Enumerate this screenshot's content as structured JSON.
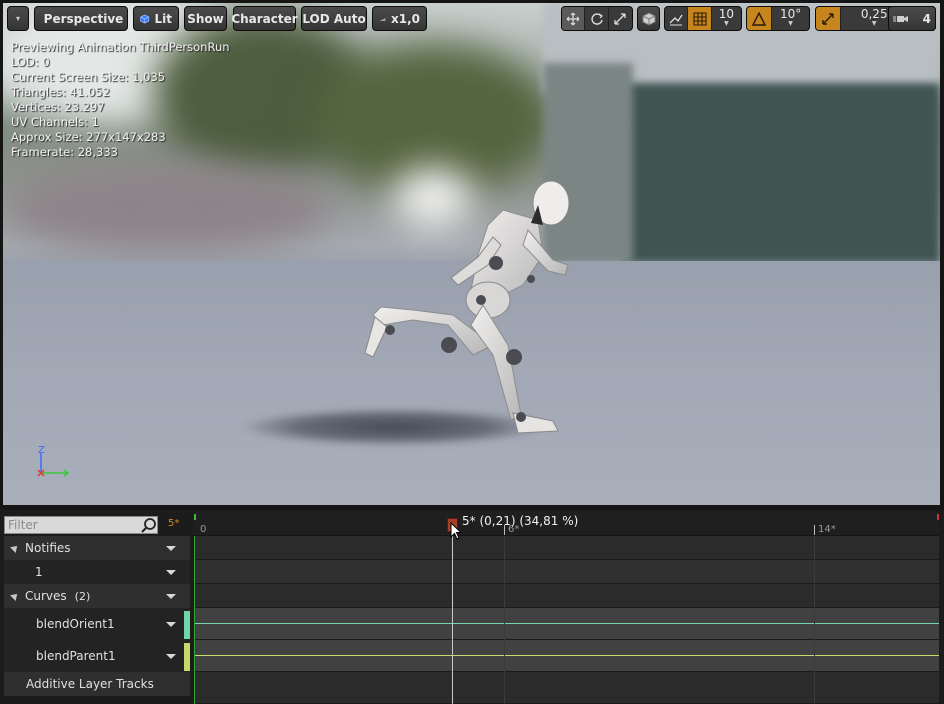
{
  "toolbar": {
    "menu_caret": "▾",
    "perspective_label": "Perspective",
    "lit_label": "Lit",
    "show_label": "Show",
    "character_label": "Character",
    "lod_label": "LOD Auto",
    "speed_label": "x1,0",
    "grid_snap_value": "10",
    "rotation_snap_value": "10°",
    "scale_snap_value": "0,25",
    "camera_speed_value": "4"
  },
  "stats": {
    "previewing": "Previewing Animation ThirdPersonRun",
    "lod": "LOD: 0",
    "screen_size": "Current Screen Size: 1,035",
    "triangles": "Triangles: 41.052",
    "vertices": "Vertices: 23.297",
    "uv_channels": "UV Channels: 1",
    "approx_size": "Approx Size: 277x147x283",
    "framerate": "Framerate: 28,333"
  },
  "axes": {
    "z_label": "Z"
  },
  "timeline": {
    "filter_placeholder": "Filter",
    "frame_marker": "5*",
    "ruler": {
      "start": "0",
      "mid": "6*",
      "end": "14*"
    },
    "playhead_label": "5* (0,21) (34,81 %)",
    "tracks": {
      "notifies_label": "Notifies",
      "notify_track_label": "1",
      "curves_label": "Curves",
      "curves_count": "(2)",
      "curve1_label": "blendOrient1",
      "curve2_label": "blendParent1",
      "additive_label": "Additive Layer Tracks"
    }
  },
  "colors": {
    "accent_orange": "#c6861d",
    "curve1_color": "#6fd6a8",
    "curve2_color": "#c9d86b",
    "playhead_handle": "#a5402a"
  }
}
